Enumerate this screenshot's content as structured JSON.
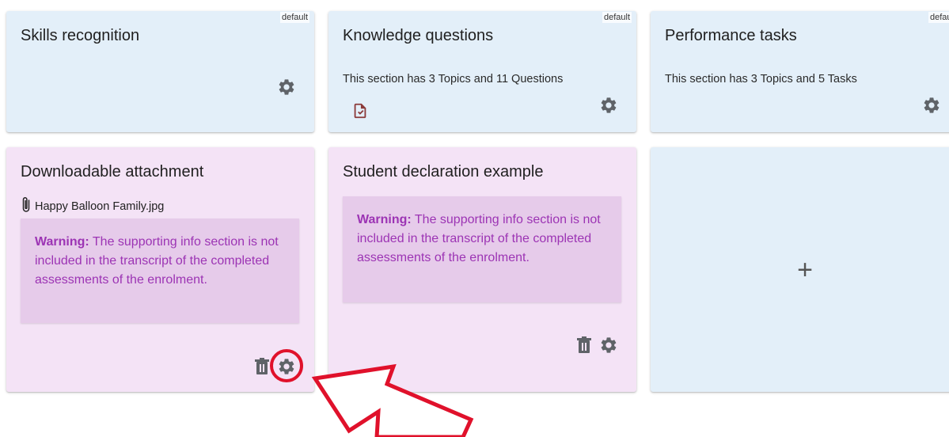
{
  "cards": {
    "skills": {
      "title": "Skills recognition",
      "badge": "default"
    },
    "knowledge": {
      "title": "Knowledge questions",
      "badge": "default",
      "subtitle": "This section has 3 Topics and 11 Questions"
    },
    "performance": {
      "title": "Performance tasks",
      "badge": "defau",
      "subtitle": "This section has 3 Topics and 5 Tasks"
    },
    "download": {
      "title": "Downloadable attachment",
      "attachment": "Happy Balloon Family.jpg",
      "warning_label": "Warning:",
      "warning_text": "The supporting info section is not included in the transcript of the completed assessments of the enrolment."
    },
    "declaration": {
      "title": "Student declaration example",
      "warning_label": "Warning:",
      "warning_text": "The supporting info section is not included in the transcript of the completed assessments of the enrolment."
    },
    "add": {
      "label": "+"
    }
  },
  "icons": {
    "settings": "gear-icon",
    "delete": "trash-icon",
    "document": "document-check-icon",
    "attachment": "paperclip-icon",
    "add": "plus-icon"
  },
  "colors": {
    "blue_card": "#e3eff9",
    "pink_card": "#f4e3f6",
    "warning_bg": "#e6cbea",
    "warning_text": "#9c34b4",
    "highlight": "#e0112b",
    "icon_gray": "#5f6368",
    "doc_icon": "#8b3a3a"
  }
}
